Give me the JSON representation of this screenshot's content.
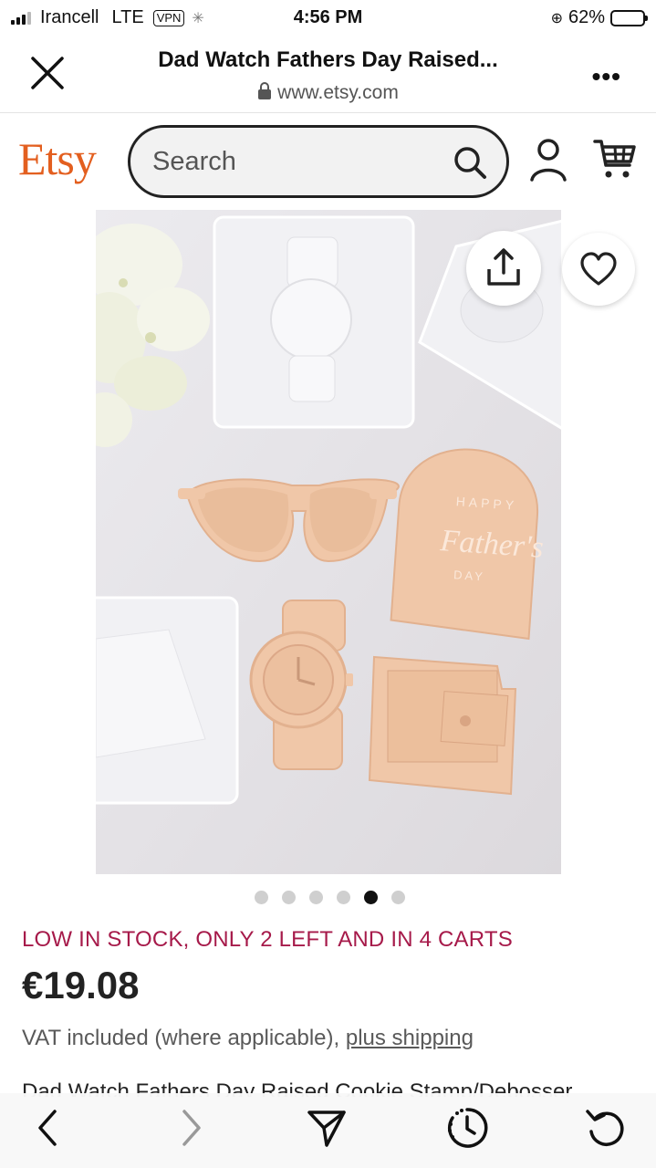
{
  "status_bar": {
    "carrier": "Irancell",
    "network": "LTE",
    "vpn": "VPN",
    "time": "4:56 PM",
    "battery": "62%",
    "battery_level": 0.62
  },
  "browser": {
    "title": "Dad Watch Fathers Day Raised...",
    "url": "www.etsy.com",
    "more_label": "•••"
  },
  "etsy_header": {
    "logo": "Etsy",
    "search_placeholder": "Search",
    "icons": [
      "search-icon",
      "account-icon",
      "cart-icon"
    ]
  },
  "product_image": {
    "stamp_text": [
      "HAPPY",
      "Father's",
      "DAY"
    ],
    "carousel_total": 6,
    "carousel_active_index": 4
  },
  "product": {
    "stock_notice": "LOW IN STOCK, ONLY 2 LEFT AND IN 4 CARTS",
    "price": "€19.08",
    "vat_text": "VAT included (where applicable), ",
    "shipping_link": "plus shipping",
    "title": "Dad Watch Fathers Day Raised Cookie Stamp/Debosser"
  },
  "toolbar": {
    "icons": [
      "back-icon",
      "forward-icon",
      "send-icon",
      "history-icon",
      "reload-icon"
    ]
  },
  "colors": {
    "etsy_orange": "#e35f1f",
    "stock_red": "#a61a4a",
    "stamp_peach": "#f0c7a8"
  }
}
